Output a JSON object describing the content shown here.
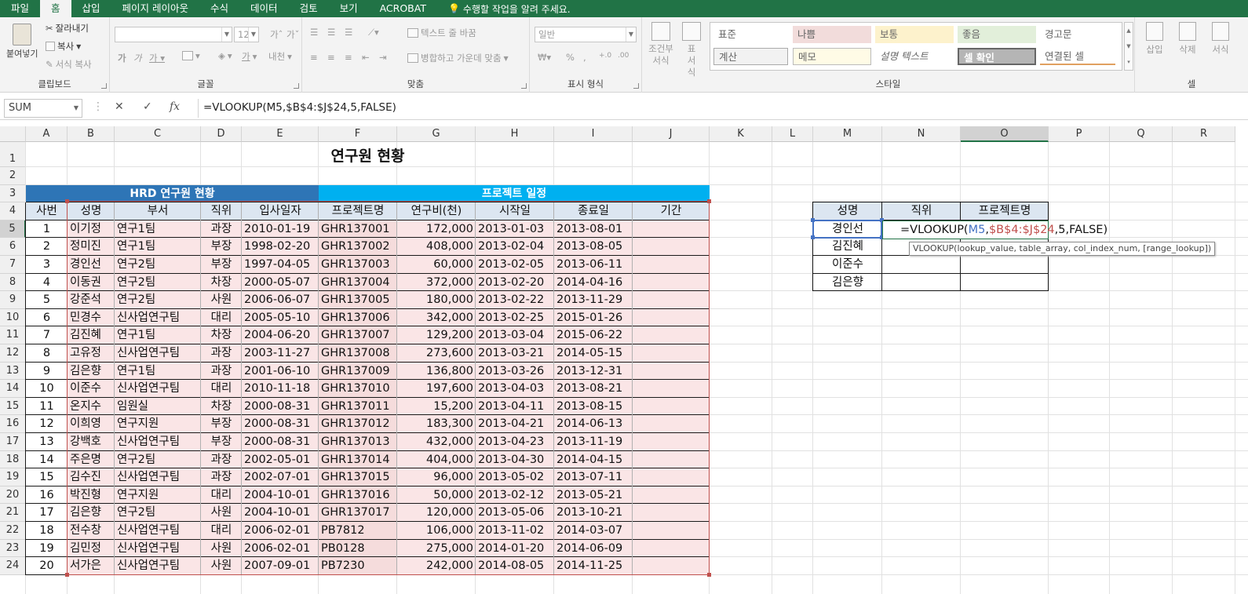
{
  "tabs": [
    "파일",
    "홈",
    "삽입",
    "페이지 레이아웃",
    "수식",
    "데이터",
    "검토",
    "보기",
    "ACROBAT"
  ],
  "active_tab": "홈",
  "tell_me": "수행할 작업을 알려 주세요.",
  "ribbon": {
    "clipboard": {
      "paste": "붙여넣기",
      "cut": "잘라내기",
      "copy": "복사",
      "format_painter": "서식 복사",
      "label": "클립보드"
    },
    "font": {
      "size": "12",
      "label": "글꼴"
    },
    "alignment": {
      "wrap": "텍스트 줄 바꿈",
      "merge": "병합하고 가운데 맞춤",
      "label": "맞춤"
    },
    "number": {
      "format": "일반",
      "label": "표시 형식"
    },
    "styles": {
      "conditional": "조건부 서식",
      "table": "표 서식",
      "label": "스타일",
      "cells": [
        "표준",
        "나쁨",
        "보통",
        "좋음",
        "경고문",
        "계산",
        "메모",
        "설명 텍스트",
        "셀 확인",
        "연결된 셀"
      ]
    },
    "cells": {
      "insert": "삽입",
      "delete": "삭제",
      "format": "서식",
      "label": "셀"
    }
  },
  "formula_bar": {
    "name_box": "SUM",
    "formula": "=VLOOKUP(M5,$B$4:$J$24,5,FALSE)"
  },
  "columns": [
    "A",
    "B",
    "C",
    "D",
    "E",
    "F",
    "G",
    "H",
    "I",
    "J",
    "K",
    "L",
    "M",
    "N",
    "O",
    "P",
    "Q",
    "R"
  ],
  "rows": [
    "1",
    "2",
    "3",
    "4",
    "5",
    "6",
    "7",
    "8",
    "9",
    "10",
    "11",
    "12",
    "13",
    "14",
    "15",
    "16",
    "17",
    "18",
    "19",
    "20",
    "21",
    "22",
    "23",
    "24"
  ],
  "sheet": {
    "title": "연구원 현황",
    "section_left": "HRD 연구원 현황",
    "section_right": "프로젝트 일정",
    "headers": [
      "사번",
      "성명",
      "부서",
      "직위",
      "입사일자",
      "프로젝트명",
      "연구비(천)",
      "시작일",
      "종료일",
      "기간"
    ],
    "records": [
      [
        "1",
        "이기정",
        "연구1팀",
        "과장",
        "2010-01-19",
        "GHR137001",
        "172,000",
        "2013-01-03",
        "2013-08-01"
      ],
      [
        "2",
        "정미진",
        "연구1팀",
        "부장",
        "1998-02-20",
        "GHR137002",
        "408,000",
        "2013-02-04",
        "2013-08-05"
      ],
      [
        "3",
        "경인선",
        "연구2팀",
        "부장",
        "1997-04-05",
        "GHR137003",
        "60,000",
        "2013-02-05",
        "2013-06-11"
      ],
      [
        "4",
        "이동권",
        "연구2팀",
        "차장",
        "2000-05-07",
        "GHR137004",
        "372,000",
        "2013-02-20",
        "2014-04-16"
      ],
      [
        "5",
        "강준석",
        "연구2팀",
        "사원",
        "2006-06-07",
        "GHR137005",
        "180,000",
        "2013-02-22",
        "2013-11-29"
      ],
      [
        "6",
        "민경수",
        "신사업연구팀",
        "대리",
        "2005-05-10",
        "GHR137006",
        "342,000",
        "2013-02-25",
        "2015-01-26"
      ],
      [
        "7",
        "김진혜",
        "연구1팀",
        "차장",
        "2004-06-20",
        "GHR137007",
        "129,200",
        "2013-03-04",
        "2015-06-22"
      ],
      [
        "8",
        "고유정",
        "신사업연구팀",
        "과장",
        "2003-11-27",
        "GHR137008",
        "273,600",
        "2013-03-21",
        "2014-05-15"
      ],
      [
        "9",
        "김은향",
        "연구1팀",
        "과장",
        "2001-06-10",
        "GHR137009",
        "136,800",
        "2013-03-26",
        "2013-12-31"
      ],
      [
        "10",
        "이준수",
        "신사업연구팀",
        "대리",
        "2010-11-18",
        "GHR137010",
        "197,600",
        "2013-04-03",
        "2013-08-21"
      ],
      [
        "11",
        "온지수",
        "임원실",
        "차장",
        "2000-08-31",
        "GHR137011",
        "15,200",
        "2013-04-11",
        "2013-08-15"
      ],
      [
        "12",
        "이희영",
        "연구지원",
        "부장",
        "2000-08-31",
        "GHR137012",
        "183,300",
        "2013-04-21",
        "2014-06-13"
      ],
      [
        "13",
        "강백호",
        "신사업연구팀",
        "부장",
        "2000-08-31",
        "GHR137013",
        "432,000",
        "2013-04-23",
        "2013-11-19"
      ],
      [
        "14",
        "주은명",
        "연구2팀",
        "과장",
        "2002-05-01",
        "GHR137014",
        "404,000",
        "2013-04-30",
        "2014-04-15"
      ],
      [
        "15",
        "김수진",
        "신사업연구팀",
        "과장",
        "2002-07-01",
        "GHR137015",
        "96,000",
        "2013-05-02",
        "2013-07-11"
      ],
      [
        "16",
        "박진형",
        "연구지원",
        "대리",
        "2004-10-01",
        "GHR137016",
        "50,000",
        "2013-02-12",
        "2013-05-21"
      ],
      [
        "17",
        "김은향",
        "연구2팀",
        "사원",
        "2004-10-01",
        "GHR137017",
        "120,000",
        "2013-05-06",
        "2013-10-21"
      ],
      [
        "18",
        "전수창",
        "신사업연구팀",
        "대리",
        "2006-02-01",
        "PB7812",
        "106,000",
        "2013-11-02",
        "2014-03-07"
      ],
      [
        "19",
        "김민정",
        "신사업연구팀",
        "사원",
        "2006-02-01",
        "PB0128",
        "275,000",
        "2014-01-20",
        "2014-06-09"
      ],
      [
        "20",
        "서가은",
        "신사업연구팀",
        "사원",
        "2007-09-01",
        "PB7230",
        "242,000",
        "2014-08-05",
        "2014-11-25"
      ]
    ],
    "lookup": {
      "headers": [
        "성명",
        "직위",
        "프로젝트명"
      ],
      "names": [
        "경인선",
        "김진혜",
        "이준수",
        "김은향"
      ],
      "editing_formula": "=VLOOKUP(M5,$B$4:$J$24,5,FALSE)",
      "tooltip": "VLOOKUP(lookup_value, table_array, col_index_num, [range_lookup])"
    }
  }
}
